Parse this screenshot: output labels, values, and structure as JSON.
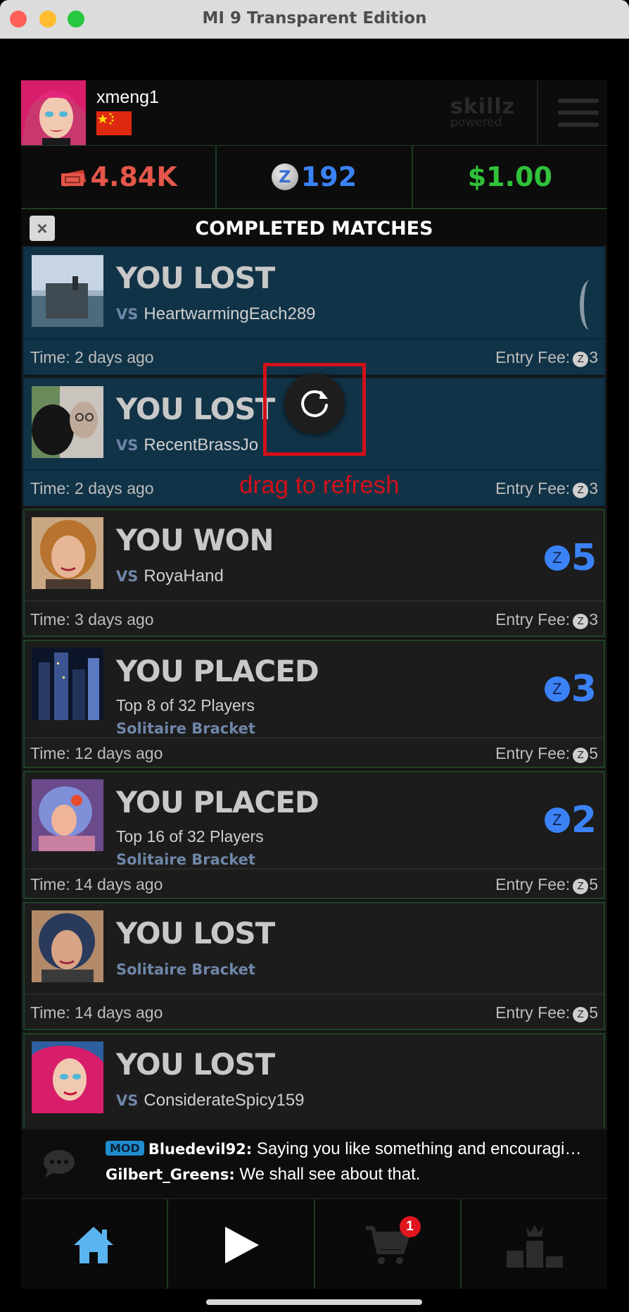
{
  "window": {
    "title": "MI 9 Transparent Edition"
  },
  "header": {
    "username": "xmeng1",
    "brand_main": "skillz",
    "brand_sub": "powered"
  },
  "currency": {
    "tickets": "4.84K",
    "zcoins": "192",
    "cash": "$1.00"
  },
  "list": {
    "title": "COMPLETED MATCHES",
    "close_symbol": "×"
  },
  "matches": [
    {
      "result": "YOU LOST",
      "opponent": "HeartwarmingEach289",
      "time": "Time: 2 days ago",
      "fee_label": "Entry Fee:",
      "fee": "3"
    },
    {
      "result": "YOU LOST",
      "opponent": "RecentBrassJo",
      "time": "Time: 2 days ago",
      "fee_label": "Entry Fee:",
      "fee": "3"
    },
    {
      "result": "YOU WON",
      "opponent": "RoyaHand",
      "prize": "5",
      "time": "Time: 3 days ago",
      "fee_label": "Entry Fee:",
      "fee": "3"
    },
    {
      "result": "YOU PLACED",
      "placement": "Top 8 of 32 Players",
      "bracket": "Solitaire Bracket",
      "prize": "3",
      "time": "Time: 12 days ago",
      "fee_label": "Entry Fee:",
      "fee": "5"
    },
    {
      "result": "YOU PLACED",
      "placement": "Top 16 of 32 Players",
      "bracket": "Solitaire Bracket",
      "prize": "2",
      "time": "Time: 14 days ago",
      "fee_label": "Entry Fee:",
      "fee": "5"
    },
    {
      "result": "YOU LOST",
      "bracket": "Solitaire Bracket",
      "time": "Time: 14 days ago",
      "fee_label": "Entry Fee:",
      "fee": "5"
    },
    {
      "result": "YOU LOST",
      "opponent": "ConsiderateSpicy159"
    }
  ],
  "vs_label": "VS",
  "coin_symbol": "Z",
  "refresh": {
    "label": "drag to refresh"
  },
  "chat": {
    "mod_badge": "MOD",
    "messages": [
      {
        "name": "Bluedevil92:",
        "text": "Saying you like something and encouragi…"
      },
      {
        "name": "Gilbert_Greens:",
        "text": "We shall see about that."
      }
    ]
  },
  "nav": {
    "cart_badge": "1",
    "icons": [
      "home-icon",
      "play-icon",
      "cart-icon",
      "leaderboard-icon"
    ]
  },
  "colors": {
    "accent_blue": "#3b82f6",
    "ticket_red": "#e4574a",
    "cash_green": "#30c23b",
    "highlight": "#d0111a"
  }
}
